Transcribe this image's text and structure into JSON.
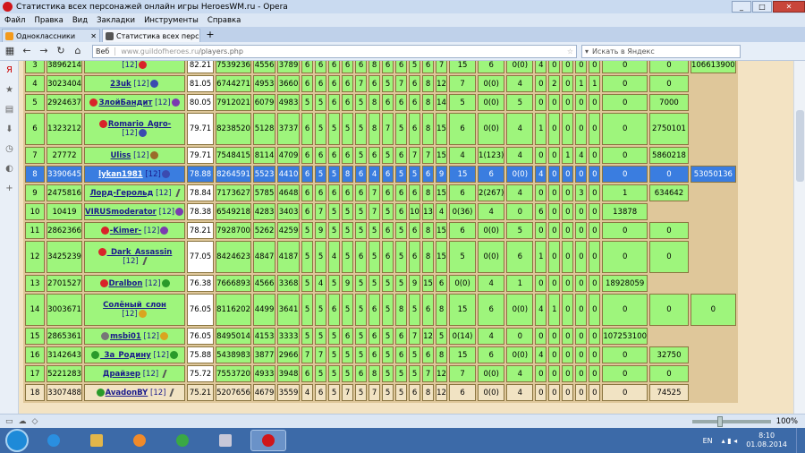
{
  "window": {
    "title": "Статистика всех персонажей онлайн игры HeroesWM.ru - Opera",
    "min": "_",
    "max": "□",
    "close": "✕"
  },
  "menu": [
    "Файл",
    "Правка",
    "Вид",
    "Закладки",
    "Инструменты",
    "Справка"
  ],
  "tabs": [
    {
      "label": "Одноклассники",
      "color": "#f39a1c"
    },
    {
      "label": "Статистика всех персо...",
      "color": "#555555"
    }
  ],
  "nav": {
    "address_prefix": "Веб",
    "address_host": "www.guildofheroes.ru",
    "address_path": "/players.php",
    "search_placeholder": "Искать в Яндекс"
  },
  "table_rows": [
    {
      "rank": "3",
      "id": "3896214",
      "nick": "",
      "lvl": "[12]",
      "icon_after": "red",
      "score": "82.21",
      "c": [
        "7539236",
        "4556",
        "3789",
        "6",
        "6",
        "6",
        "6",
        "6",
        "8",
        "6",
        "6",
        "5",
        "6",
        "7",
        "15",
        "6",
        "0(0)",
        "4",
        "0",
        "0",
        "0",
        "0",
        "0",
        "0",
        "106613900"
      ],
      "style": "",
      "tall": false,
      "icon_before": ""
    },
    {
      "rank": "4",
      "id": "3023404",
      "nick": "23uk",
      "lvl": "[12]",
      "icon_after": "blue",
      "score": "81.05",
      "c": [
        "6744271",
        "4953",
        "3660",
        "6",
        "6",
        "6",
        "6",
        "7",
        "6",
        "5",
        "7",
        "6",
        "8",
        "12",
        "7",
        "0(0)",
        "4",
        "0",
        "2",
        "0",
        "1",
        "1",
        "0",
        "0"
      ],
      "style": "",
      "tall": false,
      "icon_before": ""
    },
    {
      "rank": "5",
      "id": "2924637",
      "nick": "ЗлойБандит",
      "lvl": "[12]",
      "icon_after": "purple",
      "score": "80.05",
      "c": [
        "7912021",
        "6079",
        "4983",
        "5",
        "5",
        "6",
        "6",
        "5",
        "8",
        "6",
        "6",
        "6",
        "8",
        "14",
        "5",
        "0(0)",
        "5",
        "0",
        "0",
        "0",
        "0",
        "0",
        "0",
        "7000"
      ],
      "style": "",
      "tall": false,
      "icon_before": "red"
    },
    {
      "rank": "6",
      "id": "1323212",
      "nick": "Romario_Agro-",
      "lvl": "[12]",
      "icon_after": "blue",
      "score": "79.71",
      "c": [
        "8238520",
        "5128",
        "3737",
        "6",
        "5",
        "5",
        "5",
        "5",
        "8",
        "7",
        "5",
        "6",
        "8",
        "15",
        "6",
        "0(0)",
        "4",
        "1",
        "0",
        "0",
        "0",
        "0",
        "0",
        "2750101"
      ],
      "style": "",
      "tall": true,
      "icon_before": "red"
    },
    {
      "rank": "7",
      "id": "27772",
      "nick": "Uliss",
      "lvl": "[12]",
      "icon_after": "brown",
      "score": "79.71",
      "c": [
        "7548415",
        "8114",
        "4709",
        "6",
        "6",
        "6",
        "6",
        "5",
        "6",
        "5",
        "6",
        "7",
        "7",
        "15",
        "4",
        "1(123)",
        "4",
        "0",
        "0",
        "1",
        "4",
        "0",
        "0",
        "5860218"
      ],
      "style": "",
      "tall": false,
      "icon_before": ""
    },
    {
      "rank": "8",
      "id": "3390645",
      "nick": "lykan1981",
      "lvl": "[12]",
      "icon_after": "blue",
      "score": "78.88",
      "c": [
        "8264591",
        "5523",
        "4410",
        "6",
        "5",
        "5",
        "8",
        "6",
        "4",
        "6",
        "5",
        "5",
        "6",
        "9",
        "15",
        "6",
        "0(0)",
        "4",
        "0",
        "0",
        "0",
        "0",
        "0",
        "0",
        "53050136"
      ],
      "style": "sel",
      "tall": false,
      "icon_before": ""
    },
    {
      "rank": "9",
      "id": "2475816",
      "nick": "Лорд-Герольд",
      "lvl": "[12]",
      "icon_after": "sword",
      "score": "78.84",
      "c": [
        "7173627",
        "5785",
        "4648",
        "6",
        "6",
        "6",
        "6",
        "6",
        "7",
        "6",
        "6",
        "6",
        "8",
        "15",
        "6",
        "2(267)",
        "4",
        "0",
        "0",
        "0",
        "3",
        "0",
        "1",
        "634642"
      ],
      "style": "",
      "tall": false,
      "icon_before": ""
    },
    {
      "rank": "10",
      "id": "10419",
      "nick": "VIRUSmoderator",
      "lvl": "[12]",
      "icon_after": "purple",
      "score": "78.38",
      "c": [
        "6549218",
        "4283",
        "3403",
        "6",
        "7",
        "5",
        "5",
        "5",
        "7",
        "5",
        "6",
        "10",
        "13",
        "4",
        "0(36)",
        "4",
        "0",
        "6",
        "0",
        "0",
        "0",
        "0",
        "13878"
      ],
      "style": "",
      "tall": false,
      "icon_before": ""
    },
    {
      "rank": "11",
      "id": "2862366",
      "nick": "-Kimer-",
      "lvl": "[12]",
      "icon_after": "purple",
      "score": "78.21",
      "c": [
        "7928700",
        "5262",
        "4259",
        "5",
        "9",
        "5",
        "5",
        "5",
        "5",
        "6",
        "5",
        "6",
        "8",
        "15",
        "6",
        "0(0)",
        "5",
        "0",
        "0",
        "0",
        "0",
        "0",
        "0",
        "0"
      ],
      "style": "",
      "tall": false,
      "icon_before": "red"
    },
    {
      "rank": "12",
      "id": "3425239",
      "nick": "_Dark_Assassin",
      "lvl": "[12]",
      "icon_after": "sword",
      "score": "77.05",
      "c": [
        "8424623",
        "4847",
        "4187",
        "5",
        "5",
        "4",
        "5",
        "6",
        "5",
        "6",
        "5",
        "6",
        "8",
        "15",
        "5",
        "0(0)",
        "6",
        "1",
        "0",
        "0",
        "0",
        "0",
        "0",
        "0"
      ],
      "style": "",
      "tall": true,
      "icon_before": "red"
    },
    {
      "rank": "13",
      "id": "2701527",
      "nick": "Dralbon",
      "lvl": "[12]",
      "icon_after": "green",
      "score": "76.38",
      "c": [
        "7666893",
        "4566",
        "3368",
        "5",
        "4",
        "5",
        "9",
        "5",
        "5",
        "5",
        "5",
        "9",
        "15",
        "6",
        "0(0)",
        "4",
        "1",
        "0",
        "0",
        "0",
        "0",
        "0",
        "18928059"
      ],
      "style": "",
      "tall": false,
      "icon_before": "red"
    },
    {
      "rank": "14",
      "id": "3003671",
      "nick": "Солёный_слон",
      "lvl": "[12]",
      "icon_after": "gold",
      "score": "76.05",
      "c": [
        "8116202",
        "4499",
        "3641",
        "5",
        "5",
        "6",
        "5",
        "5",
        "6",
        "5",
        "8",
        "5",
        "6",
        "8",
        "15",
        "6",
        "0(0)",
        "4",
        "1",
        "0",
        "0",
        "0",
        "0",
        "0",
        "0"
      ],
      "style": "",
      "tall": true,
      "icon_before": ""
    },
    {
      "rank": "15",
      "id": "2865361",
      "nick": "msbi01",
      "lvl": "[12]",
      "icon_after": "gold",
      "score": "76.05",
      "c": [
        "8495014",
        "4153",
        "3333",
        "5",
        "5",
        "5",
        "6",
        "5",
        "6",
        "5",
        "6",
        "7",
        "12",
        "5",
        "0(14)",
        "4",
        "0",
        "0",
        "0",
        "0",
        "0",
        "0",
        "107253100"
      ],
      "style": "",
      "tall": false,
      "icon_before": "gray"
    },
    {
      "rank": "16",
      "id": "3142643",
      "nick": "_За_Родину",
      "lvl": "[12]",
      "icon_after": "green",
      "score": "75.88",
      "c": [
        "5438983",
        "3877",
        "2966",
        "7",
        "7",
        "5",
        "5",
        "5",
        "6",
        "5",
        "6",
        "5",
        "6",
        "8",
        "15",
        "6",
        "0(0)",
        "4",
        "0",
        "0",
        "0",
        "0",
        "0",
        "32750"
      ],
      "style": "",
      "tall": false,
      "icon_before": "green"
    },
    {
      "rank": "17",
      "id": "5221283",
      "nick": "Драйзер",
      "lvl": "[12]",
      "icon_after": "sword",
      "score": "75.72",
      "c": [
        "7553720",
        "4933",
        "3948",
        "6",
        "5",
        "5",
        "5",
        "6",
        "8",
        "5",
        "5",
        "5",
        "7",
        "12",
        "7",
        "0(0)",
        "4",
        "0",
        "0",
        "0",
        "0",
        "0",
        "0",
        "0"
      ],
      "style": "",
      "tall": false,
      "icon_before": ""
    },
    {
      "rank": "18",
      "id": "3307488",
      "nick": "AvadonBY",
      "lvl": "[12]",
      "icon_after": "sword",
      "score": "75.21",
      "c": [
        "5207656",
        "4679",
        "3559",
        "4",
        "6",
        "5",
        "7",
        "5",
        "7",
        "5",
        "5",
        "6",
        "8",
        "12",
        "6",
        "0(0)",
        "4",
        "0",
        "0",
        "0",
        "0",
        "0",
        "0",
        "74525"
      ],
      "style": "beige",
      "tall": false,
      "icon_before": "green"
    }
  ],
  "status": {
    "zoom": "100%"
  },
  "tray": {
    "lang": "EN",
    "time": "8:10",
    "date": "01.08.2014"
  }
}
